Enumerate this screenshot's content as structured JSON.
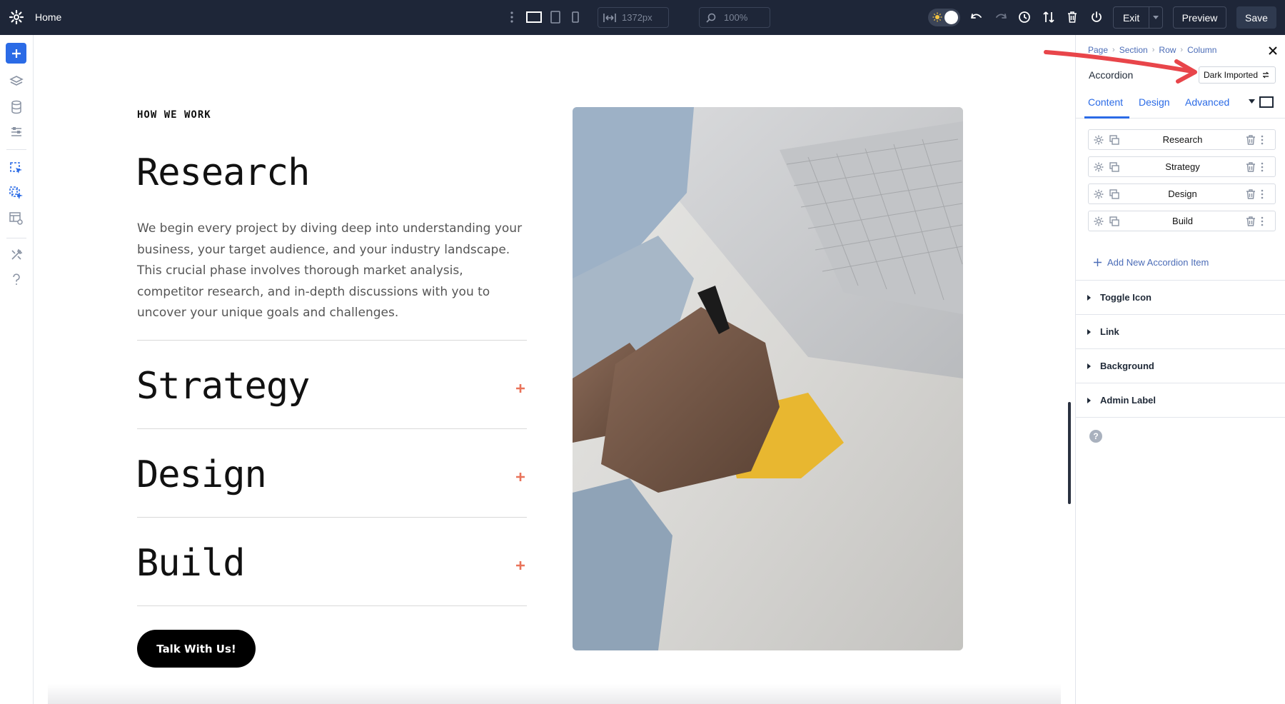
{
  "topbar": {
    "title": "Home",
    "width_value": "1372px",
    "zoom_value": "100%",
    "exit_label": "Exit",
    "preview_label": "Preview",
    "save_label": "Save"
  },
  "canvas": {
    "eyebrow": "HOW WE WORK",
    "open_item": {
      "title": "Research",
      "body": "We begin every project by diving deep into understanding your business, your target audience, and your industry landscape. This crucial phase involves thorough market analysis, competitor research, and in-depth discussions with you to uncover your unique goals and challenges."
    },
    "closed_items": [
      {
        "title": "Strategy"
      },
      {
        "title": "Design"
      },
      {
        "title": "Build"
      }
    ],
    "cta_label": "Talk With Us!",
    "accent_color": "#e9735a"
  },
  "panel": {
    "breadcrumb": [
      "Page",
      "Section",
      "Row",
      "Column"
    ],
    "module_title": "Accordion",
    "preset_label": "Dark Imported",
    "tabs": [
      "Content",
      "Design",
      "Advanced"
    ],
    "active_tab": "Content",
    "items": [
      {
        "label": "Research"
      },
      {
        "label": "Strategy"
      },
      {
        "label": "Design"
      },
      {
        "label": "Build"
      }
    ],
    "add_item_label": "Add New Accordion Item",
    "sections": [
      {
        "label": "Toggle Icon"
      },
      {
        "label": "Link"
      },
      {
        "label": "Background"
      },
      {
        "label": "Admin Label"
      }
    ],
    "help_icon": "?"
  },
  "colors": {
    "topbar_bg": "#1e2638",
    "primary_blue": "#2b6be6",
    "annotation_arrow": "#e8454a"
  }
}
